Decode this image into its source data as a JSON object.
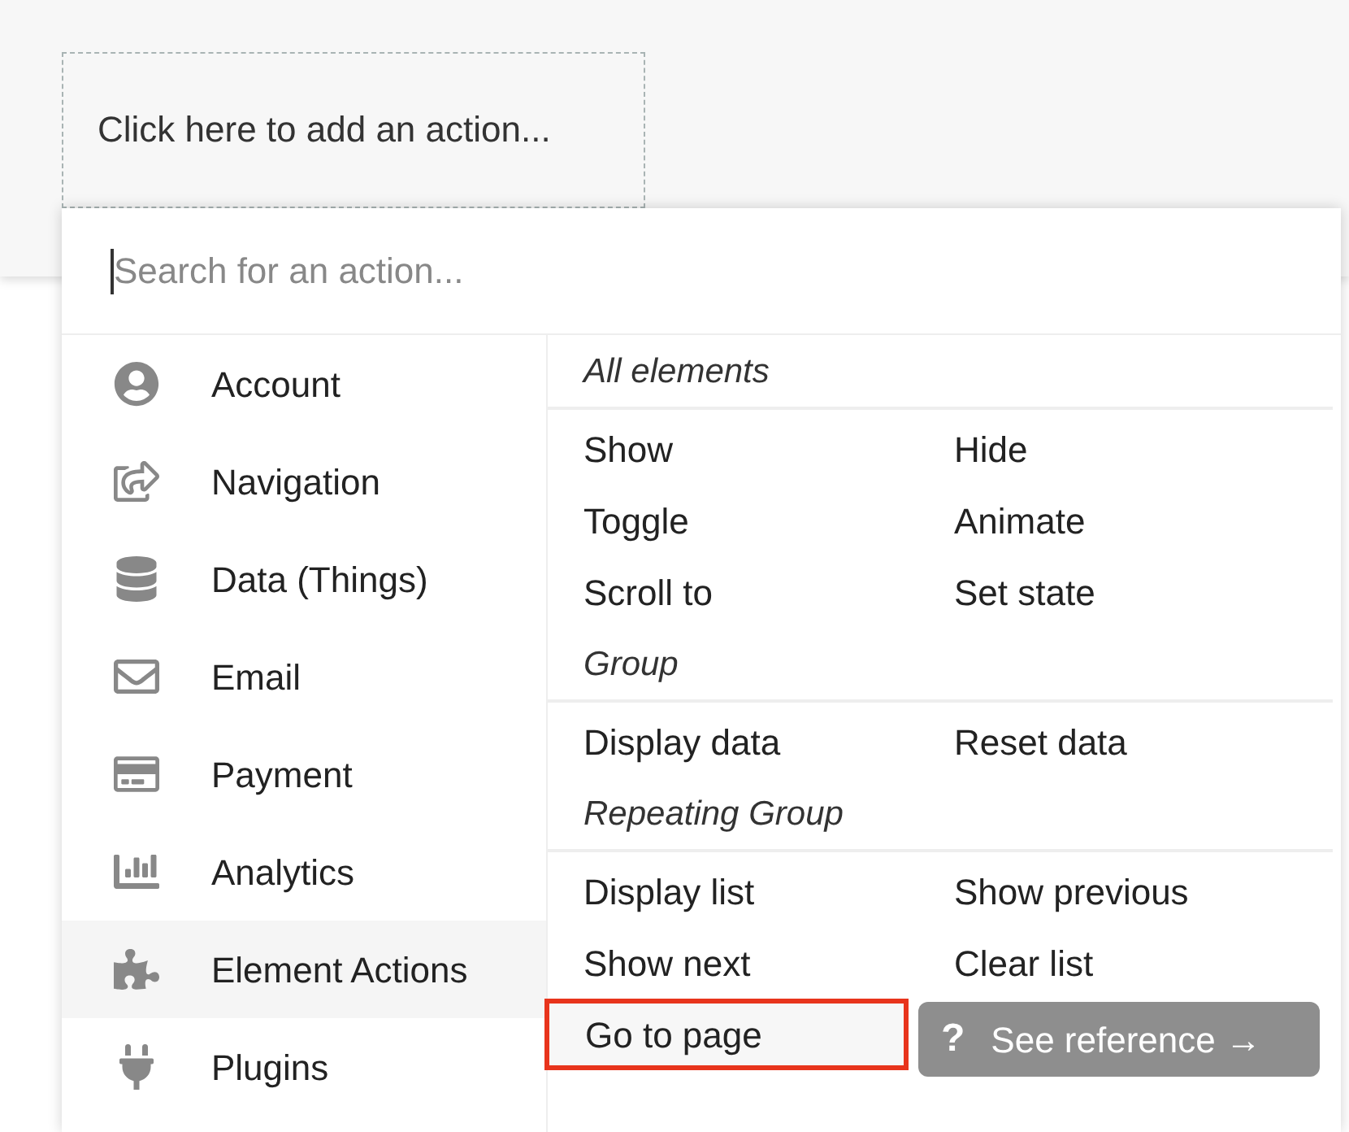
{
  "action_slot": {
    "text": "Click here to add an action..."
  },
  "search": {
    "placeholder": "Search for an action..."
  },
  "categories": [
    {
      "label": "Account",
      "selected": false
    },
    {
      "label": "Navigation",
      "selected": false
    },
    {
      "label": "Data (Things)",
      "selected": false
    },
    {
      "label": "Email",
      "selected": false
    },
    {
      "label": "Payment",
      "selected": false
    },
    {
      "label": "Analytics",
      "selected": false
    },
    {
      "label": "Element Actions",
      "selected": true
    },
    {
      "label": "Plugins",
      "selected": false
    }
  ],
  "sections": [
    {
      "title": "All elements",
      "actions": [
        {
          "label": "Show",
          "selected": false
        },
        {
          "label": "Hide",
          "selected": false
        },
        {
          "label": "Toggle",
          "selected": false
        },
        {
          "label": "Animate",
          "selected": false
        },
        {
          "label": "Scroll to",
          "selected": false
        },
        {
          "label": "Set state",
          "selected": false
        }
      ]
    },
    {
      "title": "Group",
      "actions": [
        {
          "label": "Display data",
          "selected": false
        },
        {
          "label": "Reset data",
          "selected": false
        }
      ]
    },
    {
      "title": "Repeating Group",
      "actions": [
        {
          "label": "Display list",
          "selected": false
        },
        {
          "label": "Show previous",
          "selected": false
        },
        {
          "label": "Show next",
          "selected": false
        },
        {
          "label": "Clear list",
          "selected": false
        },
        {
          "label": "Go to page",
          "selected": true
        }
      ]
    }
  ],
  "tooltip": {
    "icon": "?",
    "text": "See reference →"
  }
}
